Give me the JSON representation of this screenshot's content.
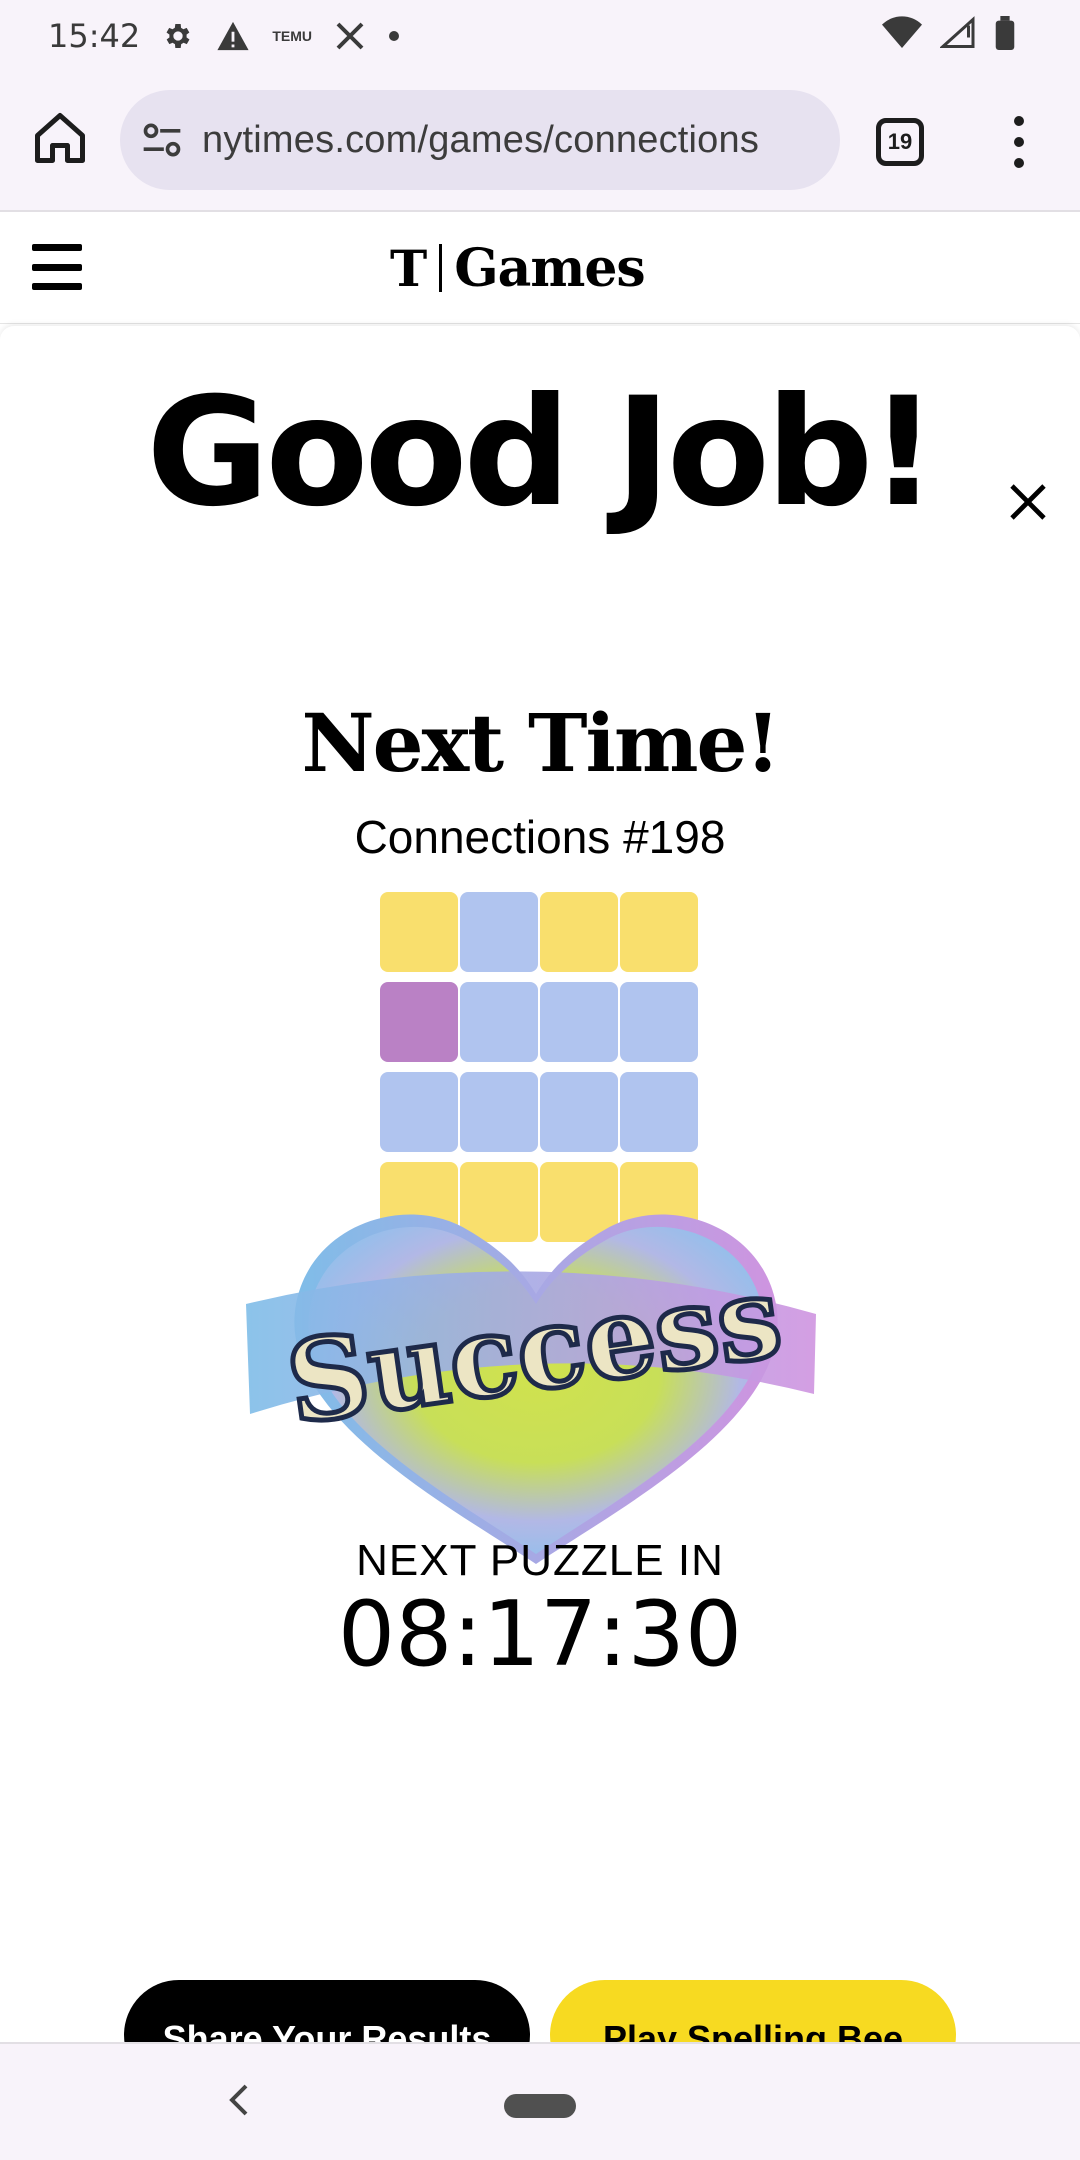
{
  "status_bar": {
    "time": "15:42",
    "left_icons": [
      "gear-icon",
      "warning-icon",
      "temu-icon",
      "x-icon",
      "dot-icon"
    ],
    "temu_text": "TEMU",
    "right_icons": [
      "wifi-icon",
      "signal-icon",
      "battery-icon"
    ]
  },
  "browser": {
    "url": "nytimes.com/games/connections",
    "tab_count": "19"
  },
  "header": {
    "logo_mark": "T",
    "logo_text": "Games"
  },
  "modal": {
    "headline": "Good Job!",
    "subtitle": "Next Time!",
    "puzzle_number": "Connections #198",
    "grid": [
      [
        "yellow",
        "blue",
        "yellow",
        "yellow"
      ],
      [
        "purple",
        "blue",
        "blue",
        "blue"
      ],
      [
        "blue",
        "blue",
        "blue",
        "blue"
      ],
      [
        "yellow",
        "yellow",
        "yellow",
        "yellow"
      ]
    ],
    "sticker_text": "Success",
    "next_label": "NEXT PUZZLE IN",
    "countdown": "08:17:30",
    "share_label": "Share Your Results",
    "spelling_label": "Play Spelling Bee"
  },
  "colors": {
    "yellow": "#f9df6d",
    "blue": "#b0c4ef",
    "purple": "#ba81c5",
    "green": "#a0c35a",
    "spelling_bee": "#f7da21"
  }
}
